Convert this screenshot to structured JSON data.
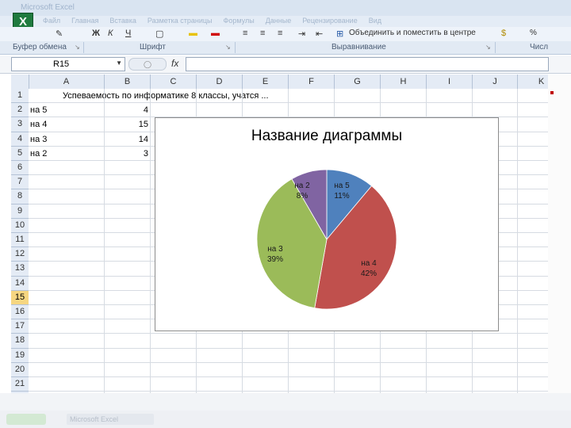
{
  "app": {
    "title_text": "Microsoft Excel"
  },
  "menu": [
    "Файл",
    "Главная",
    "Вставка",
    "Разметка страницы",
    "Формулы",
    "Данные",
    "Рецензирование",
    "Вид"
  ],
  "ribbon": {
    "groups": {
      "clipboard": "Буфер обмена",
      "font": "Шрифт",
      "alignment": "Выравнивание",
      "number": "Числ"
    },
    "merge_label": "Объединить и поместить в центре",
    "icons": [
      "clipboard-icon",
      "bold-icon",
      "italic-icon",
      "underline-icon",
      "border-icon",
      "fill-color-icon",
      "font-color-icon",
      "align-left-icon",
      "align-center-icon",
      "align-right-icon",
      "indent-icon",
      "merge-icon",
      "currency-icon"
    ]
  },
  "formula_bar": {
    "name_box": "R15",
    "fx": "fx",
    "formula": ""
  },
  "columns": [
    "A",
    "B",
    "C",
    "D",
    "E",
    "F",
    "G",
    "H",
    "I",
    "J",
    "K"
  ],
  "rows": [
    "1",
    "2",
    "3",
    "4",
    "5",
    "6",
    "7",
    "8",
    "9",
    "10",
    "11",
    "12",
    "13",
    "14",
    "15",
    "16",
    "17",
    "18",
    "19",
    "20",
    "21"
  ],
  "selected_row": "15",
  "cells": {
    "title": "Успеваемость по информатике 8 классы, учатся ...",
    "labels": [
      "на 5",
      "на 4",
      "на 3",
      "на 2"
    ],
    "values": [
      "4",
      "15",
      "14",
      "3"
    ]
  },
  "chart_data": {
    "type": "pie",
    "title": "Название диаграммы",
    "categories": [
      "на 5",
      "на 4",
      "на 3",
      "на 2"
    ],
    "values": [
      4,
      15,
      14,
      3
    ],
    "percent_labels": [
      "11%",
      "42%",
      "39%",
      "8%"
    ],
    "colors": [
      "#4f81bd",
      "#c0504d",
      "#9bbb59",
      "#8064a2"
    ]
  },
  "accent": {
    "selected_row": "#f6d681",
    "excel_green": "#1f7a3e"
  }
}
